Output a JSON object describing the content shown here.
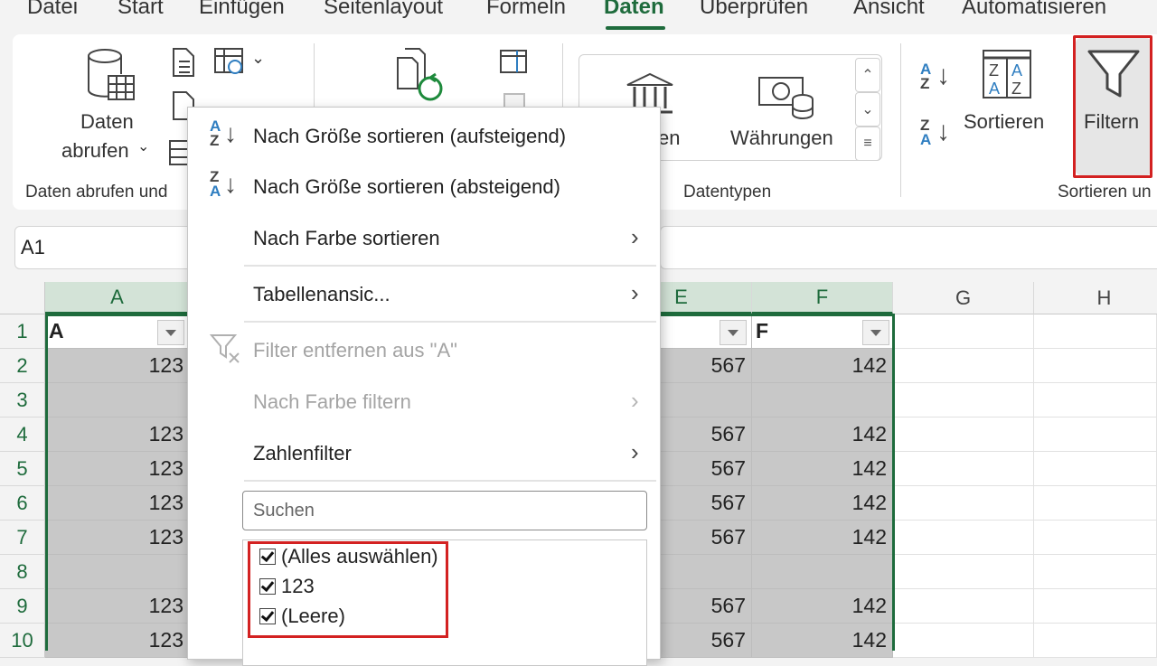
{
  "ribbon_tabs": [
    "Datei",
    "Start",
    "Einfügen",
    "Seitenlayout",
    "Formeln",
    "Daten",
    "Überprüfen",
    "Ansicht",
    "Automatisieren"
  ],
  "active_tab": "Daten",
  "ribbon": {
    "get_data_line1": "Daten",
    "get_data_line2": "abrufen",
    "group_get_data": "Daten abrufen und",
    "datatype_partial": "en",
    "currencies": "Währungen",
    "group_datatypes": "Datentypen",
    "sort": "Sortieren",
    "filter": "Filtern",
    "group_sort_filter": "Sortieren un"
  },
  "formula_bar": {
    "name_box": "A1"
  },
  "columns": [
    "A",
    "E",
    "F",
    "G",
    "H"
  ],
  "rows": [
    "1",
    "2",
    "3",
    "4",
    "5",
    "6",
    "7",
    "8",
    "9",
    "10"
  ],
  "table": {
    "headers": {
      "A": "A",
      "F": "F"
    },
    "col_A": [
      "123",
      "",
      "123",
      "123",
      "123",
      "123",
      "",
      "123",
      "123"
    ],
    "col_E": [
      "567",
      "",
      "567",
      "567",
      "567",
      "567",
      "",
      "567",
      "567"
    ],
    "col_F": [
      "142",
      "",
      "142",
      "142",
      "142",
      "142",
      "",
      "142",
      "142"
    ]
  },
  "filter_menu": {
    "sort_asc": "Nach Größe sortieren (aufsteigend)",
    "sort_desc": "Nach Größe sortieren (absteigend)",
    "sort_color": "Nach Farbe sortieren",
    "table_view": "Tabellenansic...",
    "clear_filter": "Filter entfernen aus \"A\"",
    "filter_color": "Nach Farbe filtern",
    "number_filter": "Zahlenfilter",
    "search_placeholder": "Suchen",
    "values": [
      {
        "label": "(Alles auswählen)",
        "checked": true
      },
      {
        "label": "123",
        "checked": true
      },
      {
        "label": "(Leere)",
        "checked": true
      }
    ]
  },
  "colors": {
    "accent": "#1e6b3c",
    "highlight": "#d32121",
    "filtered_cell": "#c8c8c8"
  }
}
